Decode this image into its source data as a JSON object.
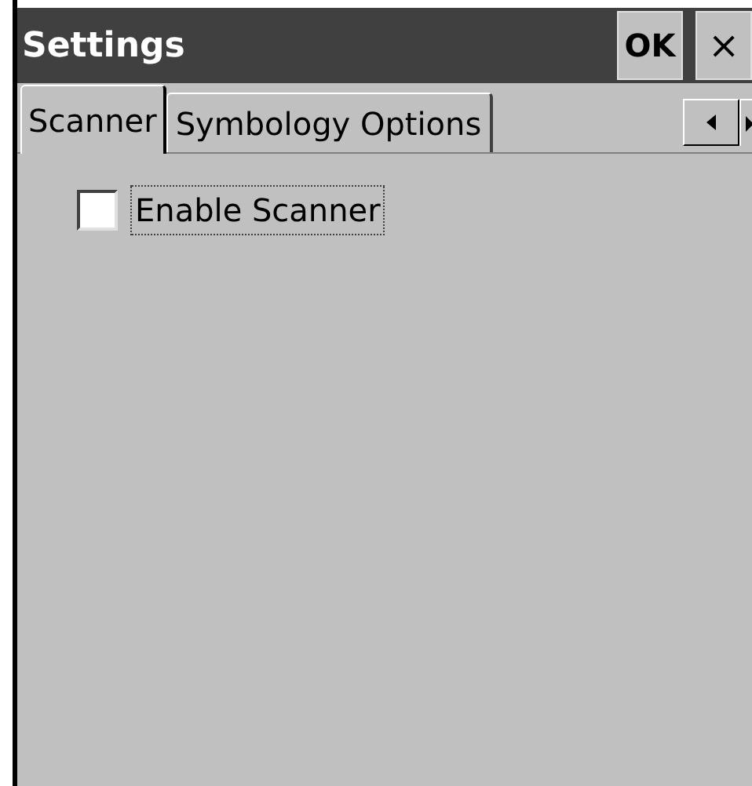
{
  "window": {
    "title": "Settings",
    "ok_button": "OK",
    "close_button": "×"
  },
  "tabs": [
    {
      "label": "Scanner",
      "selected": true
    },
    {
      "label": "Symbology Options",
      "selected": false
    }
  ],
  "options": [
    {
      "label": "Enable Scanner",
      "checked": false,
      "focused": true
    }
  ]
}
